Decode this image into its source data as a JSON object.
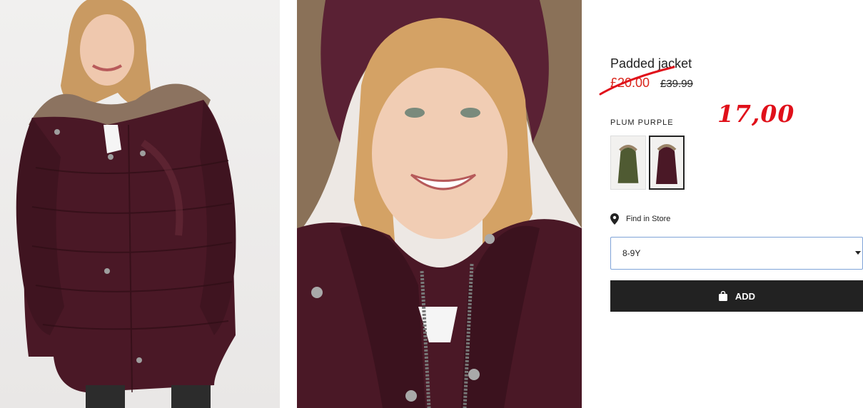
{
  "product": {
    "title": "Padded jacket",
    "sale_price": "£20.00",
    "original_price": "£39.99",
    "annotation": "17,00",
    "color_label": "PLUM PURPLE",
    "swatches": [
      {
        "name": "khaki green",
        "color": "#4f5a32"
      },
      {
        "name": "plum purple",
        "color": "#4a1826"
      }
    ]
  },
  "find_store": {
    "label": "Find in Store",
    "icon": "location-pin-icon"
  },
  "size_select": {
    "value": "8-9Y"
  },
  "add_button": {
    "label": "ADD",
    "icon": "shopping-bag-icon"
  },
  "colors": {
    "sale": "#d9261c",
    "annotation": "#e0101a",
    "button_bg": "#222222",
    "select_border": "#7fa3d8",
    "jacket": "#4a1826"
  }
}
